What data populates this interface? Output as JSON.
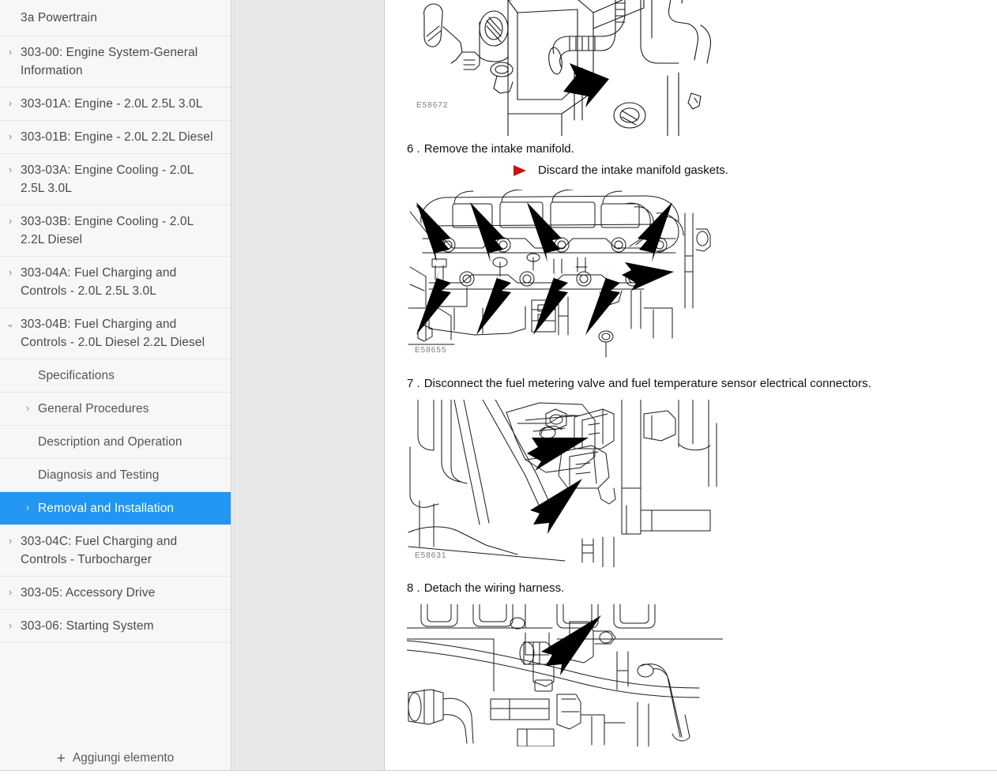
{
  "sidebar": {
    "root_label": "3a Powertrain",
    "add_item_label": "Aggiungi elemento",
    "add_icon": "plus-icon",
    "chevron_collapsed": "›",
    "chevron_expanded": "⌄",
    "selected_color": "#2196f3",
    "items": [
      {
        "label": "303-00: Engine System-General Information",
        "chevron": "›",
        "depth": 0,
        "selected": false
      },
      {
        "label": "303-01A: Engine - 2.0L 2.5L 3.0L",
        "chevron": "›",
        "depth": 0,
        "selected": false
      },
      {
        "label": "303-01B: Engine - 2.0L 2.2L Diesel",
        "chevron": "›",
        "depth": 0,
        "selected": false
      },
      {
        "label": "303-03A: Engine Cooling - 2.0L 2.5L 3.0L",
        "chevron": "›",
        "depth": 0,
        "selected": false
      },
      {
        "label": "303-03B: Engine Cooling - 2.0L 2.2L Diesel",
        "chevron": "›",
        "depth": 0,
        "selected": false
      },
      {
        "label": "303-04A: Fuel Charging and Controls - 2.0L 2.5L 3.0L",
        "chevron": "›",
        "depth": 0,
        "selected": false
      },
      {
        "label": "303-04B: Fuel Charging and Controls - 2.0L Diesel 2.2L Diesel",
        "chevron": "⌄",
        "depth": 0,
        "selected": false
      },
      {
        "label": "Specifications",
        "chevron": "",
        "depth": 1,
        "selected": false
      },
      {
        "label": "General Procedures",
        "chevron": "›",
        "depth": 1,
        "selected": false
      },
      {
        "label": "Description and Operation",
        "chevron": "",
        "depth": 1,
        "selected": false
      },
      {
        "label": "Diagnosis and Testing",
        "chevron": "",
        "depth": 1,
        "selected": false
      },
      {
        "label": "Removal and Installation",
        "chevron": "›",
        "depth": 1,
        "selected": true
      },
      {
        "label": "303-04C: Fuel Charging and Controls - Turbocharger",
        "chevron": "›",
        "depth": 0,
        "selected": false
      },
      {
        "label": "303-05: Accessory Drive",
        "chevron": "›",
        "depth": 0,
        "selected": false
      },
      {
        "label": "303-06: Starting System",
        "chevron": "›",
        "depth": 0,
        "selected": false
      }
    ]
  },
  "document": {
    "steps": [
      {
        "number": "",
        "text": "",
        "note": "",
        "figure_code": "E58672",
        "figure_name": "engine-hose-connection-diagram"
      },
      {
        "number": "6 .",
        "text": "Remove the intake manifold.",
        "note": "Discard the intake manifold gaskets.",
        "figure_code": "E58655",
        "figure_name": "intake-manifold-bolts-diagram"
      },
      {
        "number": "7 .",
        "text": "Disconnect the fuel metering valve and fuel temperature sensor electrical connectors.",
        "note": "",
        "figure_code": "E58631",
        "figure_name": "fuel-metering-valve-connectors-diagram"
      },
      {
        "number": "8 .",
        "text": "Detach the wiring harness.",
        "note": "",
        "figure_code": "",
        "figure_name": "wiring-harness-diagram"
      }
    ]
  }
}
